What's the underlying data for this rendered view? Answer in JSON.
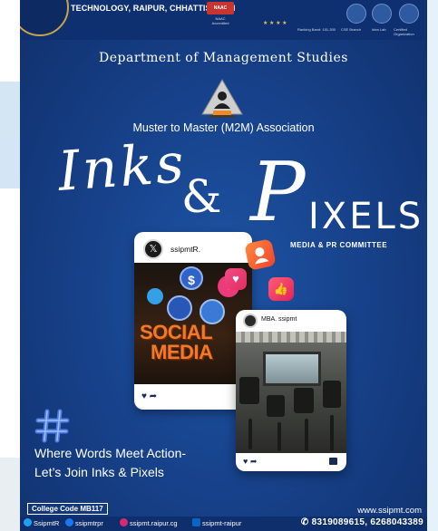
{
  "header": {
    "institution": "TECHNOLOGY, RAIPUR, CHHATTISGARH",
    "naac_badge": "NAAC",
    "naac_sub": "NAAC Accredited",
    "ranking": "Ranking Band: 151-300",
    "cse_branch": "CSE Branch",
    "idea_lab": "Idea Lab",
    "certified": "Certified Organization"
  },
  "department": "Department of Management Studies",
  "association": "Muster to Master (M2M) Association",
  "title": {
    "inks": "Inks",
    "amp": "&",
    "p": "P",
    "ixels": "IXELS"
  },
  "committee": "MEDIA & PR COMMITTEE",
  "card1": {
    "handle": "ssipmtR.",
    "avatar_icon": "x-logo-icon",
    "image_text_line1": "SOCIAL",
    "image_text_line2": "MEDIA"
  },
  "card2": {
    "handle": "MBA. ssipmt"
  },
  "tagline": {
    "line1": "Where Words Meet Action-",
    "line2": "Let’s Join Inks & Pixels"
  },
  "college_code": "College Code MB117",
  "website": "www.ssipmt.com",
  "footer": {
    "twitter": "SsipmtR",
    "facebook": "ssipmtrpr",
    "instagram": "ssipmt.raipur.cg",
    "linkedin": "ssipmt-raipur",
    "phone": "8319089615, 6268043389"
  },
  "colors": {
    "poster_bg": "#163f86",
    "accent_orange": "#f07a2a",
    "accent_pink": "#ed3a7b"
  }
}
